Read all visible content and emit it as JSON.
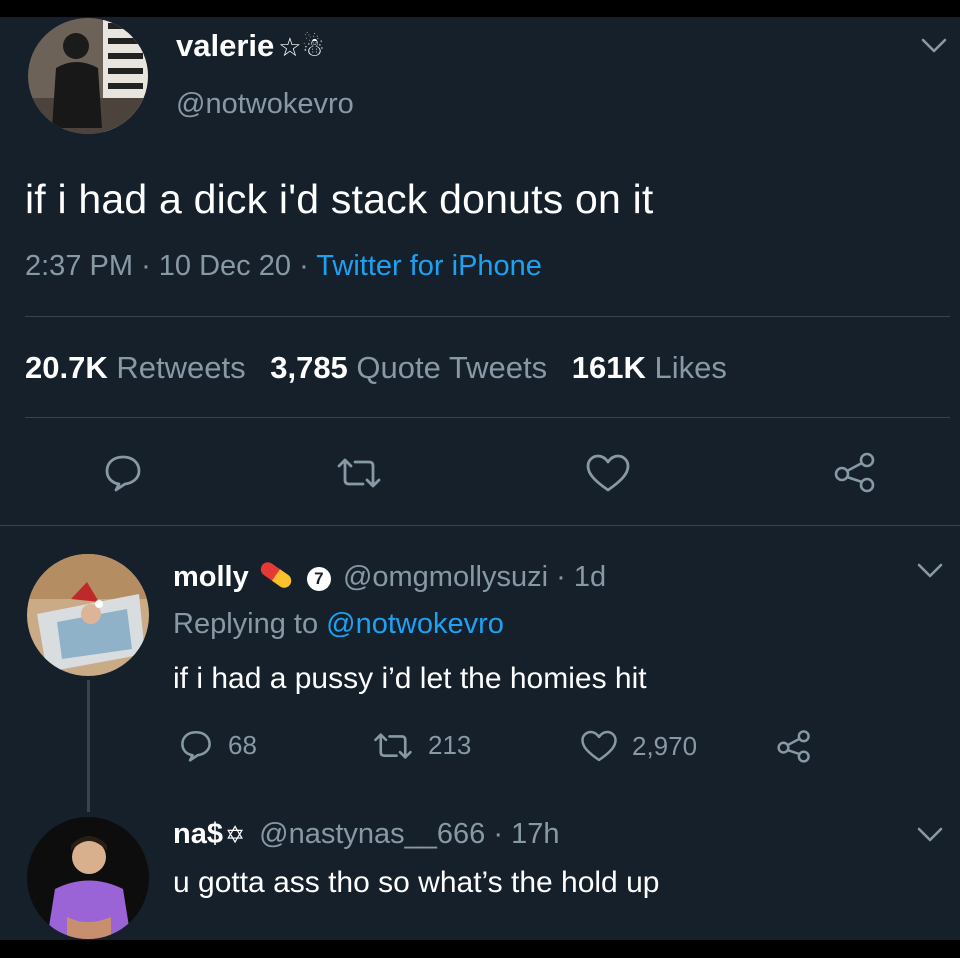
{
  "main_tweet": {
    "display_name": "valerie",
    "name_emoji": "☆☃",
    "handle": "@notwokevro",
    "text": "if i had a dick i'd stack donuts on it",
    "time": "2:37 PM",
    "date": "10 Dec 20",
    "client": "Twitter for iPhone",
    "separator": "·",
    "stats": {
      "retweets_count": "20.7K",
      "retweets_label": "Retweets",
      "quotes_count": "3,785",
      "quotes_label": "Quote Tweets",
      "likes_count": "161K",
      "likes_label": "Likes"
    }
  },
  "replies": [
    {
      "display_name": "molly",
      "badge": "7",
      "handle": "@omgmollysuzi",
      "age": "· 1d",
      "replying_prefix": "Replying to",
      "replying_to": "@notwokevro",
      "text": "if i had a pussy i’d let the homies hit",
      "reply_count": "68",
      "retweet_count": "213",
      "like_count": "2,970"
    },
    {
      "display_name": "na$",
      "name_emoji": "✡",
      "handle": "@nastynas__666",
      "age": "· 17h",
      "text": "u gotta ass tho so what’s the hold up"
    }
  ],
  "colors": {
    "background": "#15202b",
    "secondary_text": "#8899a6",
    "link": "#1da1f2",
    "divider": "#38444d"
  },
  "icons": [
    "chevron-down-icon",
    "reply-icon",
    "retweet-icon",
    "like-icon",
    "share-icon",
    "pill-icon"
  ]
}
